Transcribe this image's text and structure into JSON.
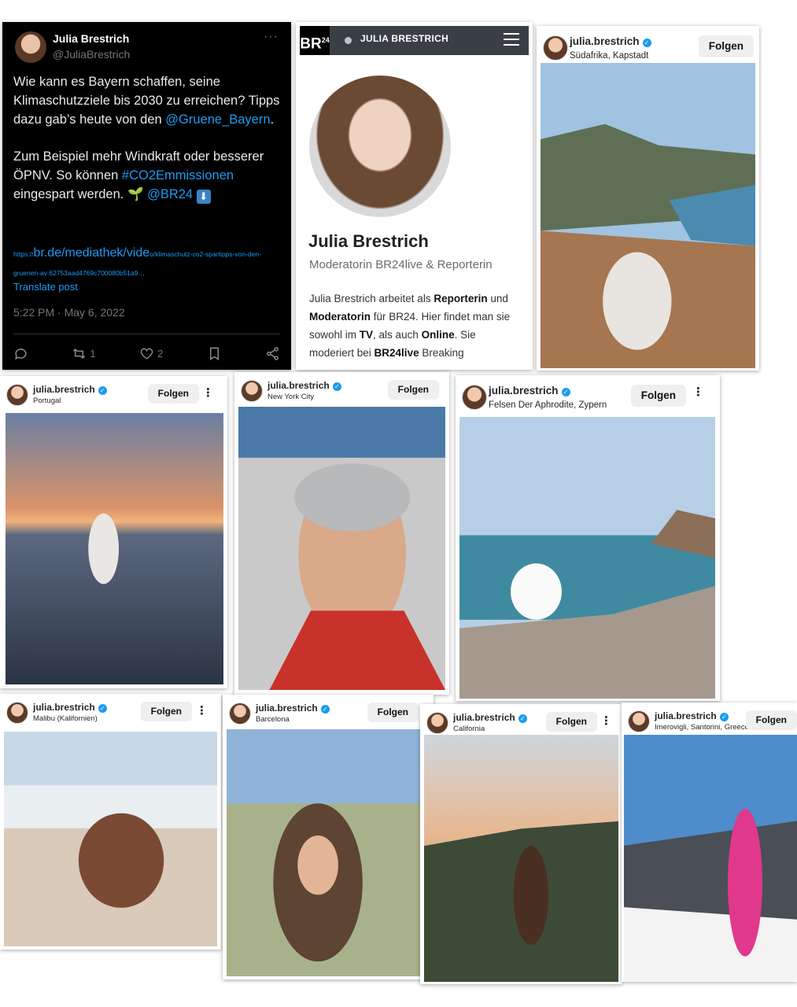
{
  "tweet": {
    "name": "Julia Brestrich",
    "handle": "@JuliaBrestrich",
    "more": "···",
    "line1": "Wie kann es Bayern schaffen, seine Klimaschutzziele bis 2030 zu erreichen? Tipps dazu gab’s heute von den",
    "mention": "@Gruene_Bayern",
    "line1_end": ".",
    "line2_a": "Zum Beispiel mehr Windkraft oder besserer ÖPNV. So können",
    "hashtag": "#CO2Emmissionen",
    "line2_b": "eingespart werden.",
    "mention2": "@BR24",
    "url_prefix": "https://",
    "url_big": "br.de/mediathek/vide",
    "url_rest": "o/klimaschutz-co2-spartipps-von-den-gruenen-av:62753aad4769c700080b51a9…",
    "translate": "Translate post",
    "timestamp": "5:22 PM · May 6, 2022",
    "retweets": "1",
    "likes": "2"
  },
  "br24": {
    "logo": "BR",
    "logo_sup": "24",
    "top_name": "JULIA BRESTRICH",
    "name": "Julia Brestrich",
    "role": "Moderatorin BR24live & Reporterin",
    "bio": [
      {
        "t": "Julia Brestrich arbeitet als "
      },
      {
        "b": "Reporterin"
      },
      {
        "t": " und "
      },
      {
        "b": "Moderatorin"
      },
      {
        "t": " für BR24. Hier findet man sie sowohl im "
      },
      {
        "b": "TV"
      },
      {
        "t": ", als auch "
      },
      {
        "b": "Online"
      },
      {
        "t": ". Sie moderiert bei "
      },
      {
        "b": "BR24live"
      },
      {
        "t": " Breaking"
      }
    ]
  },
  "instagram": {
    "username": "julia.brestrich",
    "follow_label": "Folgen",
    "posts": [
      {
        "location": "Südafrika, Kapstadt",
        "scene": "mountain-cliff",
        "colors": [
          "#9fc3e0",
          "#5f6f55",
          "#a57650"
        ]
      },
      {
        "location": "Portugal",
        "scene": "sunset-sea",
        "colors": [
          "#d9936a",
          "#5b6880",
          "#2b3443"
        ]
      },
      {
        "location": "New York City",
        "scene": "street-selfie",
        "colors": [
          "#4c7aa8",
          "#c9c9c9",
          "#c8322a"
        ]
      },
      {
        "location": "Felsen Der Aphrodite, Zypern",
        "scene": "sea-rocks",
        "colors": [
          "#b7cfe6",
          "#3f8aa0",
          "#a4998c"
        ]
      },
      {
        "location": "Malibu (Kalifornien)",
        "scene": "beach",
        "colors": [
          "#c7d9e6",
          "#d9cab9",
          "#b8a58f"
        ]
      },
      {
        "location": "Barcelona",
        "scene": "park-guell",
        "colors": [
          "#8fb4d8",
          "#a8b28a",
          "#5e4432"
        ]
      },
      {
        "location": "California",
        "scene": "cliff-sunset",
        "colors": [
          "#e7b891",
          "#7a8891",
          "#3d4a38"
        ]
      },
      {
        "location": "Imerovigli, Santorini, Greece",
        "scene": "santorini",
        "colors": [
          "#4f8ccc",
          "#f3f3f3",
          "#4a4e56"
        ]
      }
    ]
  }
}
